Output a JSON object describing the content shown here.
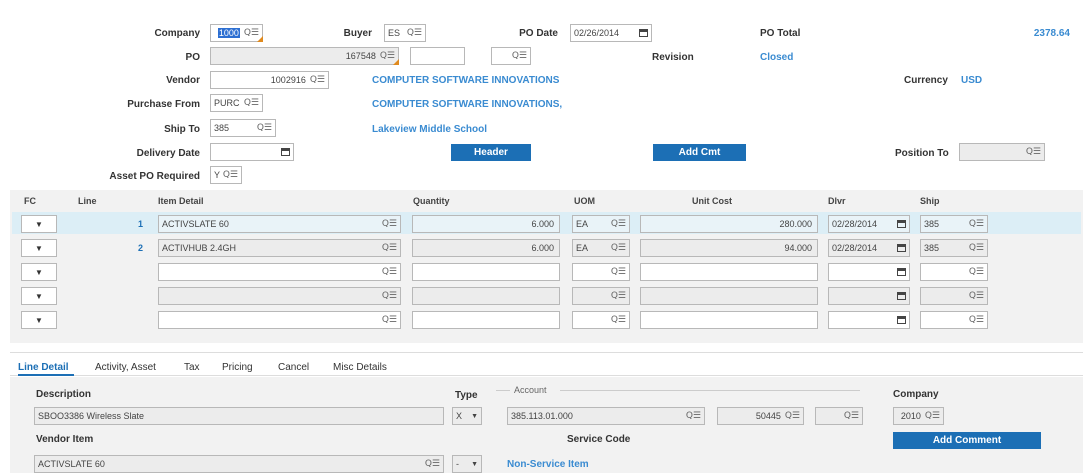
{
  "header": {
    "company_label": "Company",
    "company_value": "1000",
    "buyer_label": "Buyer",
    "buyer_value": "ES",
    "po_date_label": "PO Date",
    "po_date_value": "02/26/2014",
    "po_total_label": "PO Total",
    "po_total_value": "2378.64",
    "po_label": "PO",
    "po_value": "167548",
    "revision_label": "Revision",
    "revision_value": "Closed",
    "vendor_label": "Vendor",
    "vendor_value": "1002916",
    "vendor_name": "COMPUTER SOFTWARE INNOVATIONS",
    "currency_label": "Currency",
    "currency_value": "USD",
    "purchase_from_label": "Purchase From",
    "purchase_from_value": "PURC",
    "purchase_from_name": "COMPUTER SOFTWARE INNOVATIONS,",
    "ship_to_label": "Ship To",
    "ship_to_value": "385",
    "ship_to_name": "Lakeview Middle School",
    "delivery_date_label": "Delivery Date",
    "header_button": "Header",
    "add_cmt_button": "Add Cmt",
    "position_to_label": "Position To",
    "asset_po_label": "Asset PO Required",
    "asset_po_value": "Y"
  },
  "grid": {
    "columns": [
      "FC",
      "Line",
      "Item Detail",
      "Quantity",
      "UOM",
      "Unit Cost",
      "Dlvr",
      "Ship"
    ],
    "rows": [
      {
        "line": "1",
        "item": "ACTIVSLATE 60",
        "qty": "6.000",
        "uom": "EA",
        "cost": "280.000",
        "dlvr": "02/28/2014",
        "ship": "385"
      },
      {
        "line": "2",
        "item": "ACTIVHUB 2.4GH",
        "qty": "6.000",
        "uom": "EA",
        "cost": "94.000",
        "dlvr": "02/28/2014",
        "ship": "385"
      }
    ]
  },
  "tabs": [
    "Line Detail",
    "Activity, Asset",
    "Tax",
    "Pricing",
    "Cancel",
    "Misc Details"
  ],
  "detail": {
    "description_label": "Description",
    "description_value": "SBOO3386  Wireless Slate",
    "type_label": "Type",
    "type_value": "X",
    "account_label": "Account",
    "account_value": "385.113.01.000",
    "account_sub": "50445",
    "company_label": "Company",
    "company_value": "2010",
    "vendor_item_label": "Vendor Item",
    "vendor_item_value": "ACTIVSLATE 60",
    "service_code_label": "Service Code",
    "service_code_dash": "-",
    "service_value": "Non-Service Item",
    "add_comment_button": "Add Comment"
  },
  "icons": {
    "lookup": "lookup-icon",
    "calendar": "calendar-icon",
    "dropdown": "chevron-down-icon"
  },
  "colors": {
    "accent": "#1c6fb5",
    "link": "#3a8bd1",
    "selected_row": "#dceef6"
  }
}
